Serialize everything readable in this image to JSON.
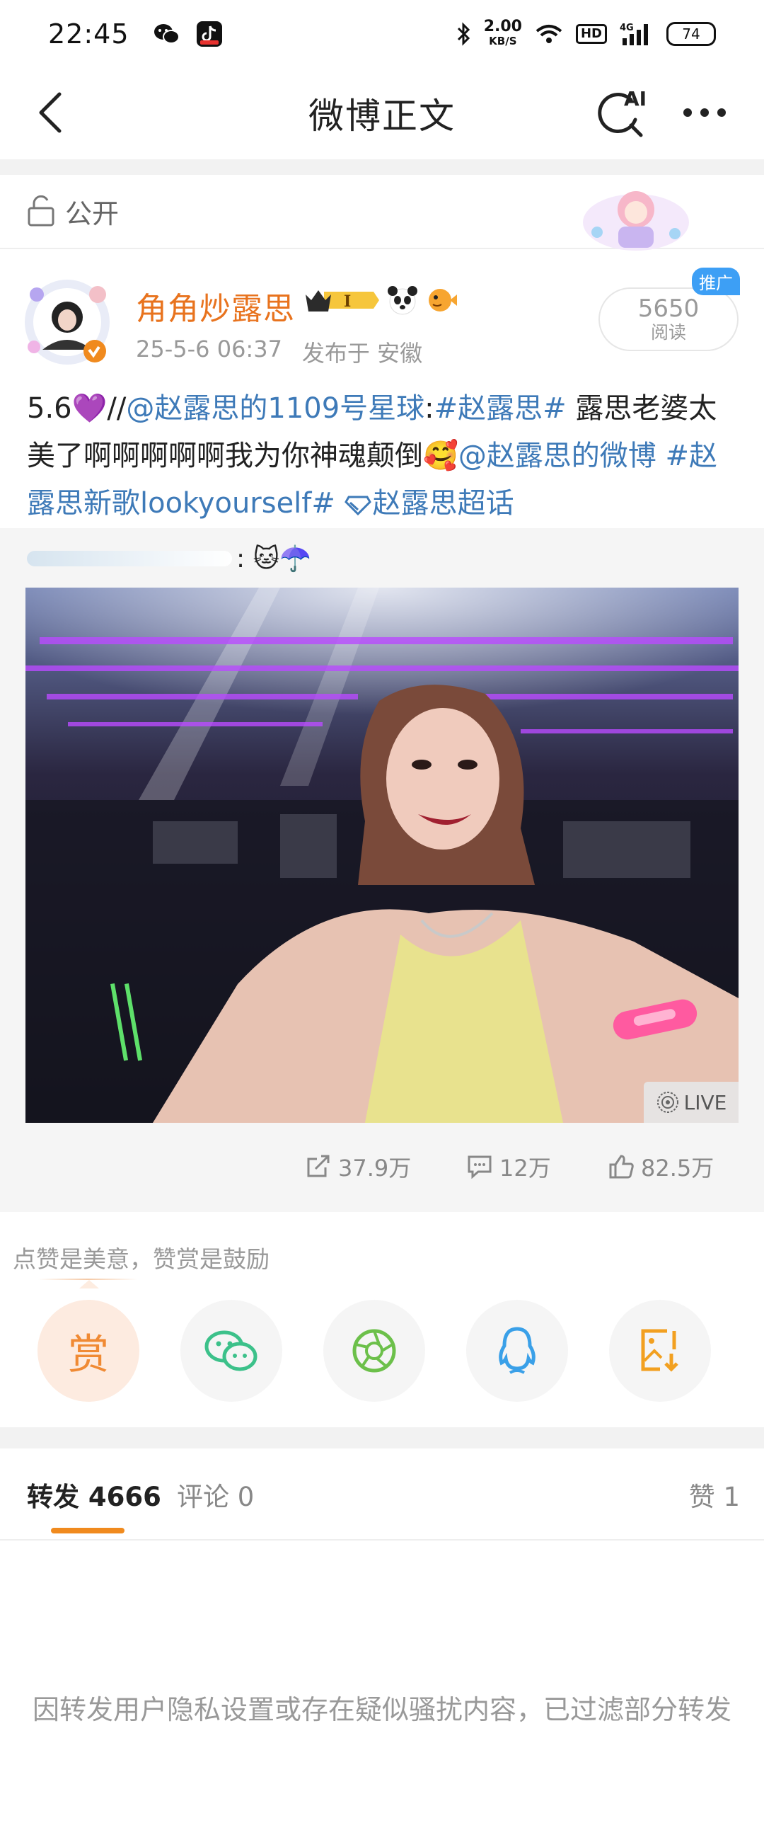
{
  "status_bar": {
    "time": "22:45",
    "net_speed_value": "2.00",
    "net_speed_unit": "KB/S",
    "hd": "HD",
    "network": "4G",
    "battery": "74"
  },
  "nav": {
    "title": "微博正文"
  },
  "privacy": {
    "label": "公开"
  },
  "post": {
    "author": "角角炒露思",
    "level_badge": "I",
    "date": "25-5-6 06:37",
    "location": "发布于 安徽",
    "read_count": "5650",
    "read_label": "阅读",
    "promo_label": "推广",
    "text_segments": [
      {
        "text": "5.6💜//",
        "type": "plain"
      },
      {
        "text": "@赵露思的1109号星球",
        "type": "link"
      },
      {
        "text": ":",
        "type": "plain"
      },
      {
        "text": "#赵露思#",
        "type": "link"
      },
      {
        "text": " 露思老婆太美了啊啊啊啊啊我为你神魂颠倒🥰",
        "type": "plain"
      },
      {
        "text": "@赵露思的微博",
        "type": "link"
      },
      {
        "text": " ",
        "type": "plain"
      },
      {
        "text": "#赵露思新歌lookyourself#",
        "type": "link"
      },
      {
        "text": " ",
        "type": "plain"
      },
      {
        "text": "赵露思超话",
        "type": "link"
      }
    ]
  },
  "embed": {
    "text": ": 🐱☂️",
    "live_label": "LIVE",
    "reposts": "37.9万",
    "comments": "12万",
    "likes": "82.5万"
  },
  "reward": {
    "tip": "点赞是美意，赞赏是鼓励",
    "reward_char": "赏"
  },
  "tabs": {
    "reposts": "转发 4666",
    "comments": "评论 0",
    "likes": "赞 1"
  },
  "filter_note": "因转发用户隐私设置或存在疑似骚扰内容，已过滤部分转发",
  "colors": {
    "brand_orange": "#e8731e",
    "link_blue": "#3e7ab8",
    "tab_indicator": "#f08a1e",
    "wechat_green": "#3cc18a",
    "moments_green": "#6cc04a",
    "qq_blue": "#3aa0e8",
    "save_orange": "#f2a020"
  }
}
